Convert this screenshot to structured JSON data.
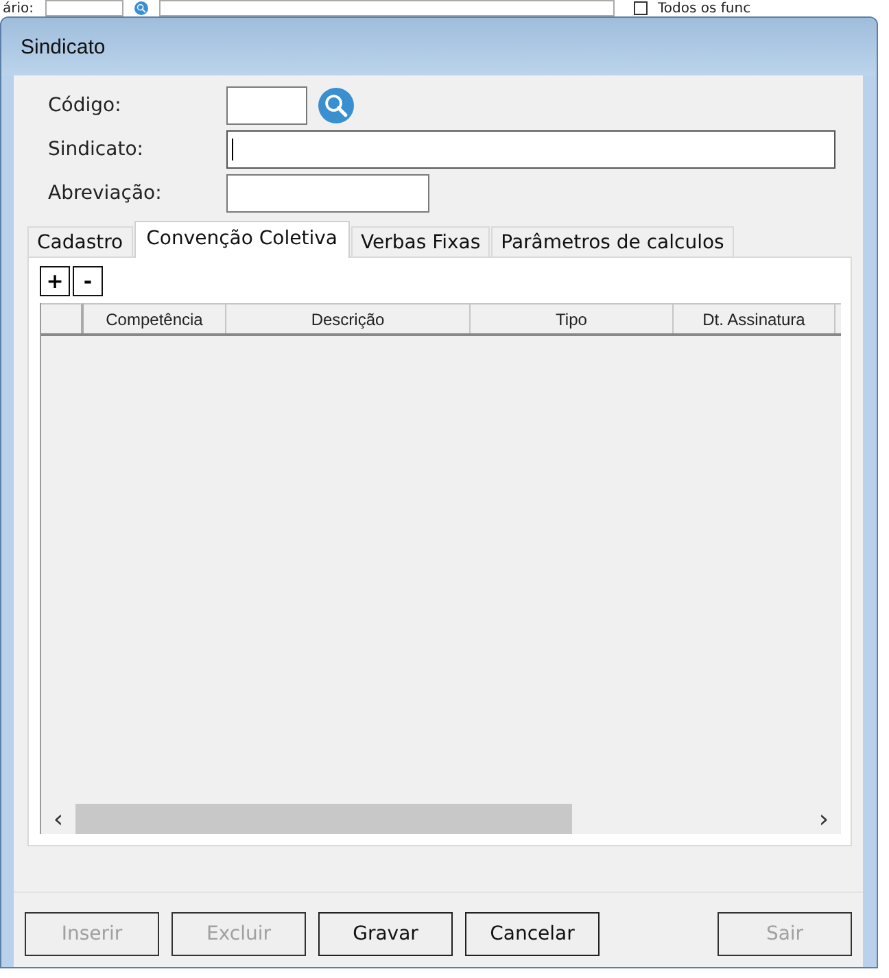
{
  "background": {
    "label": "ário:",
    "checkbox": {
      "label": "Todos os func",
      "checked": false
    }
  },
  "window": {
    "title": "Sindicato"
  },
  "fields": [
    {
      "label": "Código:",
      "kind": "lookup",
      "focused": false
    },
    {
      "label": "Sindicato:",
      "kind": "wide",
      "focused": true
    },
    {
      "label": "Abreviação:",
      "kind": "medium",
      "focused": false
    }
  ],
  "tabs": [
    {
      "label": "Cadastro",
      "selected": false
    },
    {
      "label": "Convenção Coletiva",
      "selected": true
    },
    {
      "label": "Verbas Fixas",
      "selected": false
    },
    {
      "label": "Parâmetros de calculos",
      "selected": false
    }
  ],
  "row_buttons": [
    "+",
    "-"
  ],
  "table": {
    "columns": [
      "Competência",
      "Descrição",
      "Tipo",
      "Dt. Assinatura"
    ],
    "scroll_left": "‹",
    "scroll_right": "›"
  },
  "buttons": [
    {
      "label": "Inserir",
      "disabled": true,
      "kind": "action"
    },
    {
      "label": "Excluir",
      "disabled": true,
      "kind": "action"
    },
    {
      "label": "Gravar",
      "disabled": false,
      "kind": "action"
    },
    {
      "label": "Cancelar",
      "disabled": false,
      "kind": "action"
    },
    {
      "label": "Sair",
      "disabled": true,
      "kind": "exit"
    }
  ]
}
